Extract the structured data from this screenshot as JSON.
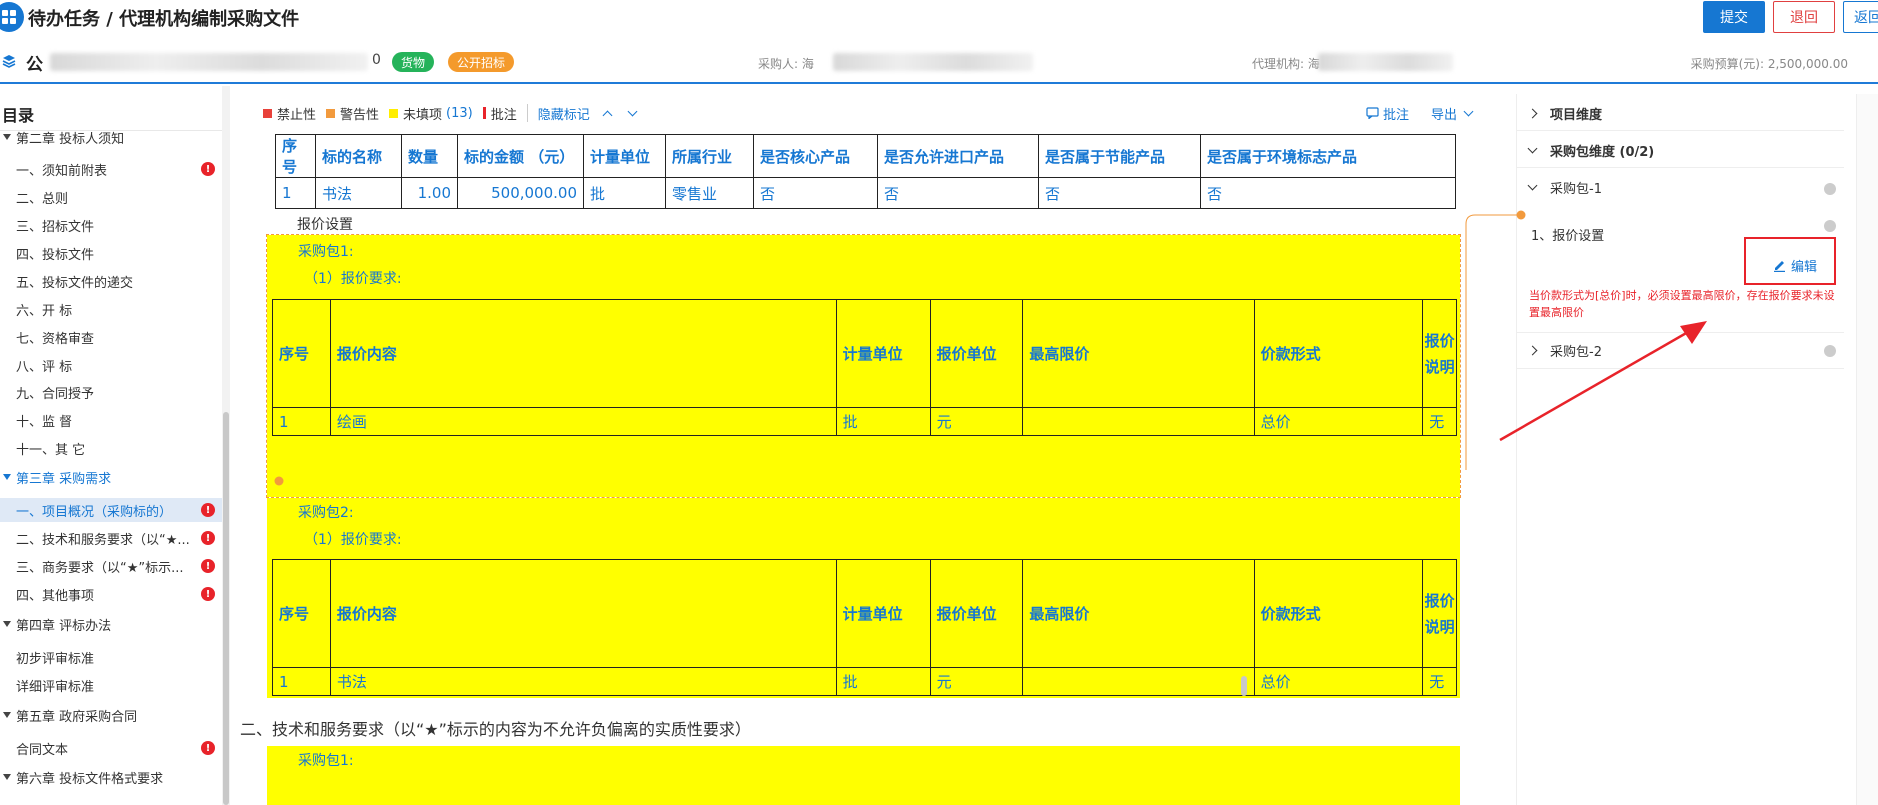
{
  "header": {
    "title": "待办任务 / 代理机构编制采购文件",
    "buttons": {
      "submit": "提交",
      "return": "退回",
      "back": "返回"
    }
  },
  "project": {
    "name_prefix": "公",
    "name_suffix": "0",
    "tags": [
      "货物",
      "公开招标"
    ],
    "purchaser_label": "采购人: 海",
    "agency_label": "代理机构: 海",
    "budget": "采购预算(元): 2,500,000.00"
  },
  "sidebar": {
    "title": "目录",
    "items": [
      {
        "label": "第二章 投标人须知",
        "level": "chapter"
      },
      {
        "label": "一、须知前附表",
        "level": "sub",
        "warn": true
      },
      {
        "label": "二、总则",
        "level": "sub"
      },
      {
        "label": "三、招标文件",
        "level": "sub"
      },
      {
        "label": "四、投标文件",
        "level": "sub"
      },
      {
        "label": "五、投标文件的递交",
        "level": "sub"
      },
      {
        "label": "六、开 标",
        "level": "sub"
      },
      {
        "label": "七、资格审查",
        "level": "sub"
      },
      {
        "label": "八、评 标",
        "level": "sub"
      },
      {
        "label": "九、合同授予",
        "level": "sub"
      },
      {
        "label": "十、监 督",
        "level": "sub"
      },
      {
        "label": "十一、其 它",
        "level": "sub"
      },
      {
        "label": "第三章 采购需求",
        "level": "chapter",
        "active": true
      },
      {
        "label": "一、项目概况（采购标的）",
        "level": "sub",
        "warn": true,
        "selected": true
      },
      {
        "label": "二、技术和服务要求（以“★...",
        "level": "sub",
        "warn": true
      },
      {
        "label": "三、商务要求（以“★”标示...",
        "level": "sub",
        "warn": true
      },
      {
        "label": "四、其他事项",
        "level": "sub",
        "warn": true
      },
      {
        "label": "第四章 评标办法",
        "level": "chapter"
      },
      {
        "label": "初步评审标准",
        "level": "sub"
      },
      {
        "label": "详细评审标准",
        "level": "sub"
      },
      {
        "label": "第五章 政府采购合同",
        "level": "chapter"
      },
      {
        "label": "合同文本",
        "level": "sub",
        "warn": true
      },
      {
        "label": "第六章 投标文件格式要求",
        "level": "chapter"
      }
    ]
  },
  "toolbar": {
    "legend": [
      {
        "label": "禁止性",
        "color": "#e8413a",
        "shape": "sq"
      },
      {
        "label": "警告性",
        "color": "#f29a3d",
        "shape": "sq"
      },
      {
        "label": "未填项",
        "color": "#ffee00",
        "shape": "sq",
        "count": "(13)"
      },
      {
        "label": "批注",
        "color": "#e8232a",
        "shape": "bar"
      }
    ],
    "hide_marks": "隐藏标记",
    "comment": "批注",
    "export": "导出"
  },
  "target_table": {
    "headers": [
      "序号",
      "标的名称",
      "数量",
      "标的金额 （元）",
      "计量单位",
      "所属行业",
      "是否核心产品",
      "是否允许进口产品",
      "是否属于节能产品",
      "是否属于环境标志产品"
    ],
    "rows": [
      [
        "1",
        "书法",
        "1.00",
        "500,000.00",
        "批",
        "零售业",
        "否",
        "否",
        "否",
        "否"
      ]
    ]
  },
  "price_setting_label": "报价设置",
  "packages": [
    {
      "title": "采购包1:",
      "sub": "（1）报价要求:",
      "headers": [
        "序号",
        "报价内容",
        "计量单位",
        "报价单位",
        "最高限价",
        "价款形式",
        "报价说明"
      ],
      "row": [
        "1",
        "绘画",
        "批",
        "元",
        "",
        "总价",
        "无"
      ]
    },
    {
      "title": "采购包2:",
      "sub": "（1）报价要求:",
      "headers": [
        "序号",
        "报价内容",
        "计量单位",
        "报价单位",
        "最高限价",
        "价款形式",
        "报价说明"
      ],
      "row": [
        "1",
        "书法",
        "批",
        "元",
        "",
        "总价",
        "无"
      ]
    }
  ],
  "section2_title": "二、技术和服务要求（以“★”标示的内容为不允许负偏离的实质性要求）",
  "package3_title": "采购包1:",
  "right_panel": {
    "project_dimension": "项目维度",
    "package_dimension": "采购包维度 (0/2)",
    "package1": "采购包-1",
    "price_setting": "1、报价设置",
    "edit": "编辑",
    "hint": "当价款形式为[总价]时，必须设置最高限价，存在报价要求未设置最高限价",
    "package2": "采购包-2"
  },
  "colors": {
    "accent": "#1677d2",
    "danger": "#e8232a",
    "highlight": "#ffff00",
    "success": "#25b35a",
    "warning": "#f49a2c"
  }
}
